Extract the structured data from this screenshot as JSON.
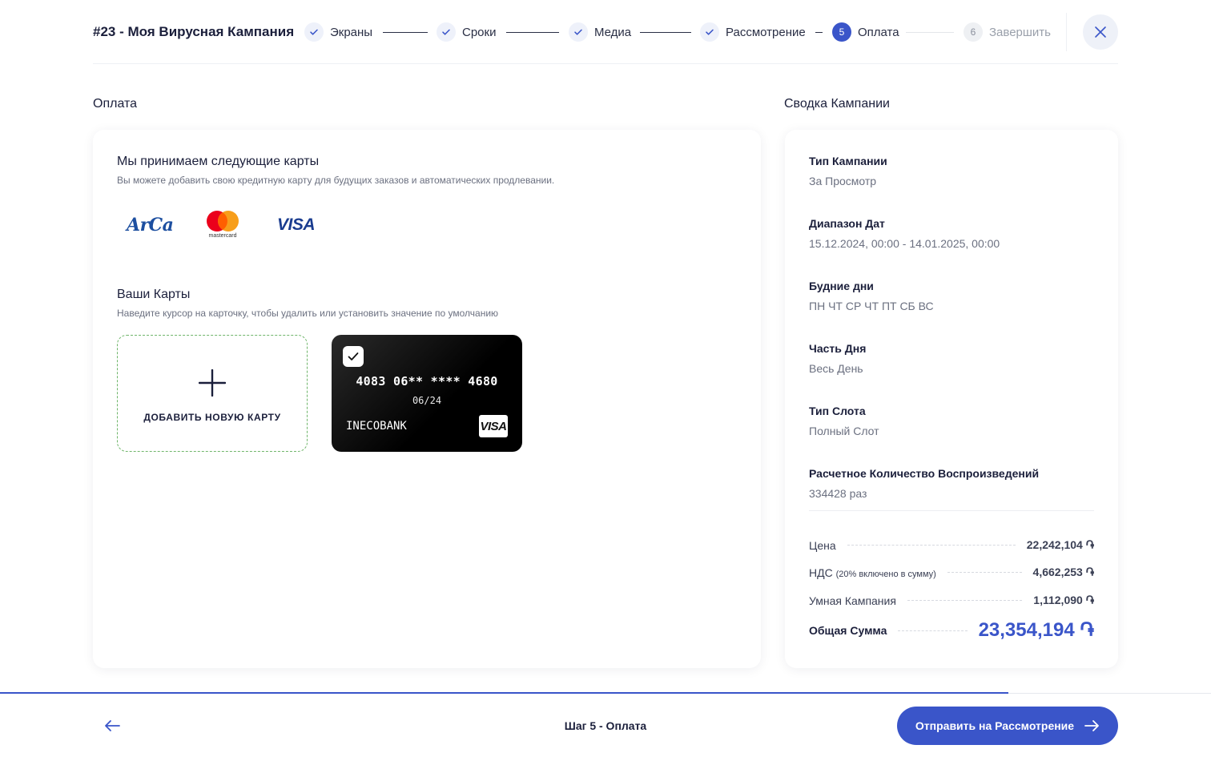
{
  "campaign": {
    "title": "#23 - Моя Вирусная Кампания"
  },
  "steps": [
    {
      "label": "Экраны",
      "state": "done"
    },
    {
      "label": "Сроки",
      "state": "done"
    },
    {
      "label": "Медиа",
      "state": "done"
    },
    {
      "label": "Рассмотрение",
      "state": "done"
    },
    {
      "number": "5",
      "label": "Оплата",
      "state": "active"
    },
    {
      "number": "6",
      "label": "Завершить",
      "state": "pending"
    }
  ],
  "payment": {
    "section_title": "Оплата",
    "accept_title": "Мы принимаем следующие карты",
    "accept_subtitle": "Вы можете добавить свою кредитную карту для будущих заказов и автоматических продлевании.",
    "logos": {
      "arca": "ArCa",
      "mastercard": "mastercard",
      "visa": "VISA"
    },
    "cards_title": "Ваши Карты",
    "cards_subtitle": "Наведите курсор на карточку, чтобы удалить или установить значение по умолчанию",
    "add_card_label": "ДОБАВИТЬ НОВУЮ КАРТУ",
    "card": {
      "number": "4083 06** **** 4680",
      "expiry": "06/24",
      "bank": "INECOBANK",
      "brand": "VISA",
      "selected": true
    }
  },
  "summary": {
    "section_title": "Сводка Кампании",
    "items": [
      {
        "label": "Тип Кампании",
        "value": "За Просмотр"
      },
      {
        "label": "Диапазон Дат",
        "value": "15.12.2024, 00:00 - 14.01.2025, 00:00"
      },
      {
        "label": "Будние дни",
        "value": "ПН ЧТ СР ЧТ ПТ СБ ВС"
      },
      {
        "label": "Часть Дня",
        "value": "Весь День"
      },
      {
        "label": "Тип Слота",
        "value": "Полный Слот"
      },
      {
        "label": "Расчетное Количество Воспроизведений",
        "value": "334428 раз"
      }
    ],
    "price": {
      "label": "Цена",
      "value": "22,242,104 ֏"
    },
    "vat": {
      "label": "НДС",
      "note": "(20% включено в сумму)",
      "value": "4,662,253 ֏"
    },
    "smart": {
      "label": "Умная Кампания",
      "value": "1,112,090 ֏"
    },
    "total": {
      "label": "Общая Сумма",
      "value": "23,354,194 ֏"
    }
  },
  "footer": {
    "step_text": "Шаг 5 - Оплата",
    "submit_label": "Отправить на Рассмотрение",
    "progress": 0.833
  },
  "colors": {
    "accent": "#3a55c9",
    "text": "#1b1f3b",
    "muted": "#6b7080",
    "card_border": "#6fb56a"
  }
}
